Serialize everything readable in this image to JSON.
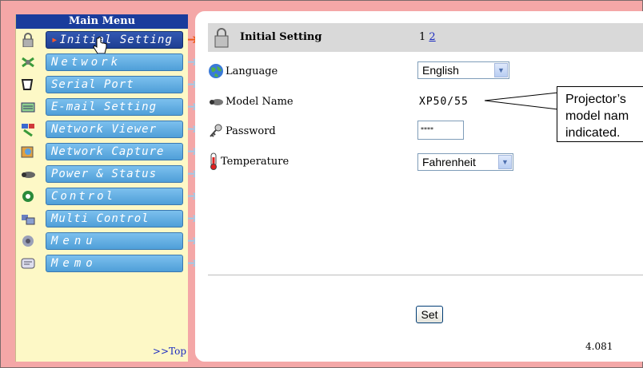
{
  "sidebar": {
    "header": "Main Menu",
    "items": [
      {
        "label": "Initial Setting",
        "icon": "lock-icon",
        "active": true
      },
      {
        "label": "Network",
        "icon": "network-icon"
      },
      {
        "label": "Serial Port",
        "icon": "serial-port-icon"
      },
      {
        "label": "E-mail Setting",
        "icon": "email-icon"
      },
      {
        "label": "Network Viewer",
        "icon": "network-viewer-icon"
      },
      {
        "label": "Network Capture",
        "icon": "network-capture-icon"
      },
      {
        "label": "Power & Status",
        "icon": "projector-icon"
      },
      {
        "label": "Control",
        "icon": "control-icon"
      },
      {
        "label": "Multi Control",
        "icon": "multi-control-icon"
      },
      {
        "label": "Menu",
        "icon": "menu-icon"
      },
      {
        "label": "Memo",
        "icon": "memo-icon"
      }
    ],
    "top_link": ">>Top"
  },
  "main": {
    "title": "Initial Setting",
    "pages": {
      "current": "1",
      "next": "2"
    },
    "language": {
      "label": "Language",
      "value": "English"
    },
    "model": {
      "label": "Model Name",
      "value": "XP50/55"
    },
    "password": {
      "label": "Password",
      "value": "****"
    },
    "temperature": {
      "label": "Temperature",
      "value": "Fahrenheit"
    },
    "set_label": "Set",
    "version": "4.081"
  },
  "callout": {
    "line1": "Projector’s",
    "line2": "model nam",
    "line3": "indicated."
  },
  "colors": {
    "background": "#f4a7a7",
    "sidebar_header": "#1a3c9c",
    "menu_button": "#4f9fd8",
    "active_button": "#1e3f92",
    "active_arrow": "#ee5a1a"
  }
}
